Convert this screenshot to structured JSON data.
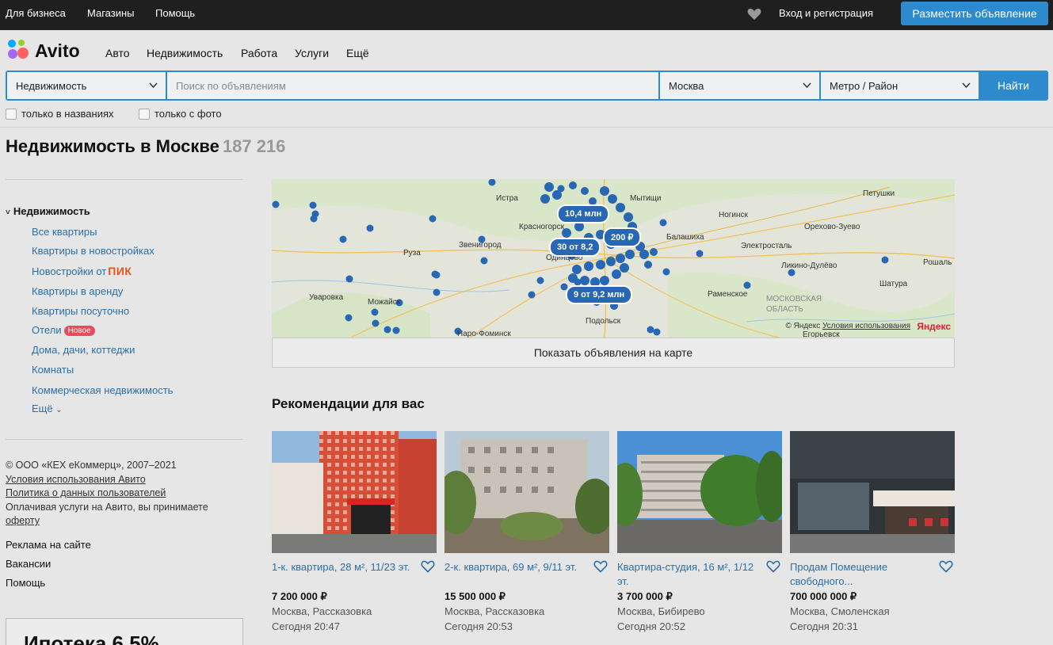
{
  "topbar": {
    "business": "Для бизнеса",
    "shops": "Магазины",
    "help": "Помощь",
    "login": "Вход и регистрация",
    "post_ad": "Разместить объявление"
  },
  "logo": {
    "text": "Avito"
  },
  "nav": {
    "auto": "Авто",
    "realty": "Недвижимость",
    "job": "Работа",
    "services": "Услуги",
    "more": "Ещё"
  },
  "search": {
    "category": "Недвижимость",
    "placeholder": "Поиск по объявлениям",
    "city": "Москва",
    "metro": "Метро / Район",
    "submit": "Найти",
    "only_titles": "только в названиях",
    "only_photo": "только с фото"
  },
  "page": {
    "title": "Недвижимость в Москве",
    "count": "187 216"
  },
  "sidebar": {
    "heading": "Недвижимость",
    "links": [
      "Все квартиры",
      "Квартиры в новостройках",
      "Новостройки от",
      "Квартиры в аренду",
      "Квартиры посуточно",
      "Отели",
      "Дома, дачи, коттеджи",
      "Комнаты",
      "Коммерческая недвижимость",
      "Ещё"
    ],
    "pik_label": "ПИК",
    "new_badge": "Новое"
  },
  "footer": {
    "copyright": "© ООО «КЕХ еКоммерц», 2007–2021",
    "terms": "Условия использования Авито",
    "privacy": "Политика о данных пользователей",
    "pay_note": "Оплачивая услуги на Авито, вы принимаете",
    "offer": "оферту",
    "ads": "Реклама на сайте",
    "jobs": "Вакансии",
    "help": "Помощь"
  },
  "promo": {
    "text": "Ипотека 6,5%"
  },
  "map": {
    "cities": [
      "Истра",
      "Красногорск",
      "Звенигород",
      "Руза",
      "Одинцово",
      "Уваровка",
      "Можайск",
      "Наро-Фоминск",
      "Подольск",
      "Мытищи",
      "Ногинск",
      "Балашиха",
      "Электросталь",
      "Орехово-Зуево",
      "Ликино-Дулёво",
      "Петушки",
      "Шатура",
      "Рошаль",
      "Раменское",
      "Егорьевск",
      "МОСКОВСКАЯ ОБЛАСТЬ"
    ],
    "clusters": [
      "10,4 млн",
      "200 ₽",
      "30 от 8,2",
      "9 от 9,2 млн"
    ],
    "copyright": "© Яндекс",
    "terms": "Условия использования",
    "yandex": "Яндекс",
    "show_button": "Показать объявления на карте"
  },
  "recommendations": {
    "title": "Рекомендации для вас",
    "cards": [
      {
        "title": "1-к. квартира, 28 м², 11/23 эт.",
        "price": "7 200 000 ₽",
        "location": "Москва, Рассказовка",
        "time": "Сегодня 20:47"
      },
      {
        "title": "2-к. квартира, 69 м², 9/11 эт.",
        "price": "15 500 000 ₽",
        "location": "Москва, Рассказовка",
        "time": "Сегодня 20:53"
      },
      {
        "title": "Квартира-студия, 16 м², 1/12 эт.",
        "price": "3 700 000 ₽",
        "location": "Москва, Бибирево",
        "time": "Сегодня 20:52"
      },
      {
        "title": "Продам Помещение свободного...",
        "price": "700 000 000 ₽",
        "location": "Москва, Смоленская",
        "time": "Сегодня 20:31"
      }
    ]
  },
  "colors": {
    "accent": "#2d8acc",
    "link": "#2b6fa8",
    "topbar": "#1f1f1f",
    "map_marker": "#2767b3"
  }
}
